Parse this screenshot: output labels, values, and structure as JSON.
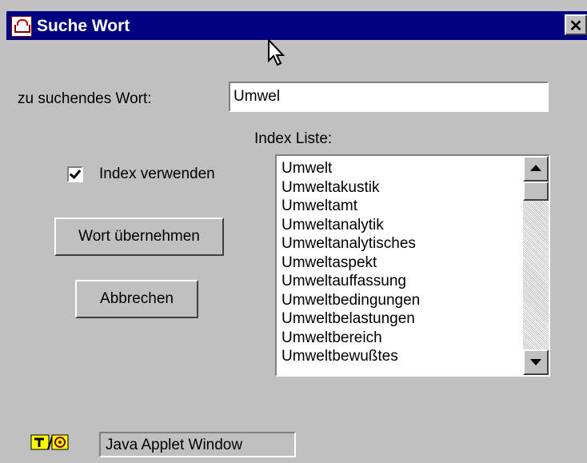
{
  "window": {
    "title": "Suche Wort",
    "close_glyph": "✕"
  },
  "form": {
    "search_label": "zu suchendes Wort:",
    "search_value": "Umwel",
    "index_list_label": "Index Liste:",
    "use_index_label": "Index verwenden",
    "use_index_checked": true
  },
  "buttons": {
    "accept_label": "Wort übernehmen",
    "cancel_label": "Abbrechen"
  },
  "index_list": {
    "items": [
      "Umwelt",
      "Umweltakustik",
      "Umweltamt",
      "Umweltanalytik",
      "Umweltanalytisches",
      "Umweltaspekt",
      "Umweltauffassung",
      "Umweltbedingungen",
      "Umweltbelastungen",
      "Umweltbereich",
      "Umweltbewußtes"
    ]
  },
  "status_bar": {
    "text": "Java Applet Window"
  },
  "icons": {
    "title": "coffee-cup-icon",
    "close": "close-icon",
    "scroll_up": "arrow-up-icon",
    "scroll_down": "arrow-down-icon",
    "status": "java-applet-icon"
  },
  "colors": {
    "title_bar": "#000080",
    "window_bg": "#c0c0c0"
  }
}
